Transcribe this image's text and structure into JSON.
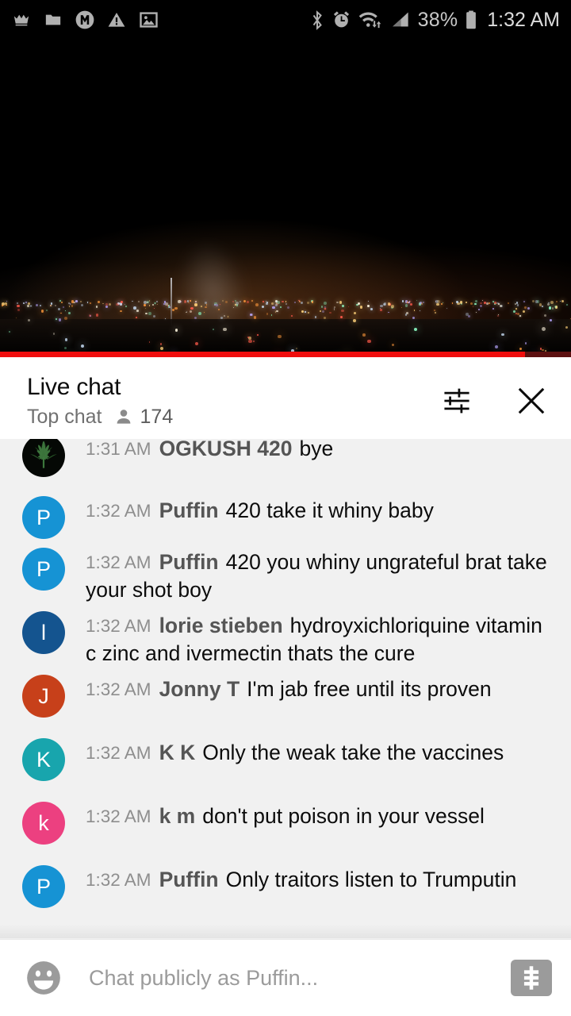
{
  "status_bar": {
    "left_icons": [
      "crown-icon",
      "folder-icon",
      "m-circle-icon",
      "warning-triangle-icon",
      "image-icon"
    ],
    "right_icons": [
      "bluetooth-icon",
      "alarm-clock-icon",
      "wifi-icon",
      "cellular-signal-icon",
      "battery-icon"
    ],
    "battery_percent": "38%",
    "time": "1:32 AM"
  },
  "video": {
    "description": "night cityscape live stream",
    "progress_percent": 92,
    "progress_color": "#f00d0d"
  },
  "chat_header": {
    "title": "Live chat",
    "mode": "Top chat",
    "viewer_count": "174",
    "viewer_icon": "person-icon",
    "settings_icon": "tune-sliders-icon",
    "close_icon": "close-x-icon"
  },
  "messages": [
    {
      "time": "1:31 AM",
      "author": "OGKUSH 420",
      "text": "bye",
      "avatar_letter": "",
      "avatar_color": "#050805",
      "avatar_type": "leaf"
    },
    {
      "time": "1:32 AM",
      "author": "Puffin",
      "text": "420 take it whiny baby",
      "avatar_letter": "P",
      "avatar_color": "#1693d4",
      "avatar_type": "letter"
    },
    {
      "time": "1:32 AM",
      "author": "Puffin",
      "text": "420 you whiny ungrateful brat take your shot boy",
      "avatar_letter": "P",
      "avatar_color": "#1693d4",
      "avatar_type": "letter"
    },
    {
      "time": "1:32 AM",
      "author": "lorie stieben",
      "text": "hydroyxichloriquine vitamin c zinc and ivermectin thats the cure",
      "avatar_letter": "l",
      "avatar_color": "#14548f",
      "avatar_type": "letter"
    },
    {
      "time": "1:32 AM",
      "author": "Jonny T",
      "text": "I'm jab free until its proven",
      "avatar_letter": "J",
      "avatar_color": "#c7401a",
      "avatar_type": "letter"
    },
    {
      "time": "1:32 AM",
      "author": "K K",
      "text": "Only the weak take the vaccines",
      "avatar_letter": "K",
      "avatar_color": "#18a5ad",
      "avatar_type": "letter"
    },
    {
      "time": "1:32 AM",
      "author": "k m",
      "text": "don't put poison in your vessel",
      "avatar_letter": "k",
      "avatar_color": "#ec4080",
      "avatar_type": "letter"
    },
    {
      "time": "1:32 AM",
      "author": "Puffin",
      "text": "Only traitors listen to Trumputin",
      "avatar_letter": "P",
      "avatar_color": "#1693d4",
      "avatar_type": "letter"
    }
  ],
  "input_bar": {
    "emoji_icon": "emoji-smiley-icon",
    "placeholder": "Chat publicly as Puffin...",
    "superchat_icon": "dollar-sign-icon"
  }
}
